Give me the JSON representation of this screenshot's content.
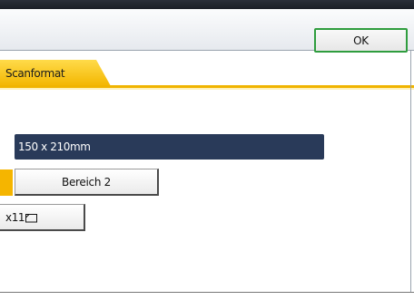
{
  "header": {
    "ok_label": "OK"
  },
  "tabs": [
    {
      "label": "Scanformat",
      "selected": true
    }
  ],
  "scan_size": {
    "display": "150 x 210mm",
    "area_button": "Bereich 2",
    "paper_button": "x11",
    "paper_orientation_icon": "landscape-orientation-icon"
  },
  "colors": {
    "accent": "#f5b500",
    "ok_border": "#2f9d3e",
    "selected_display": "#293a59"
  }
}
